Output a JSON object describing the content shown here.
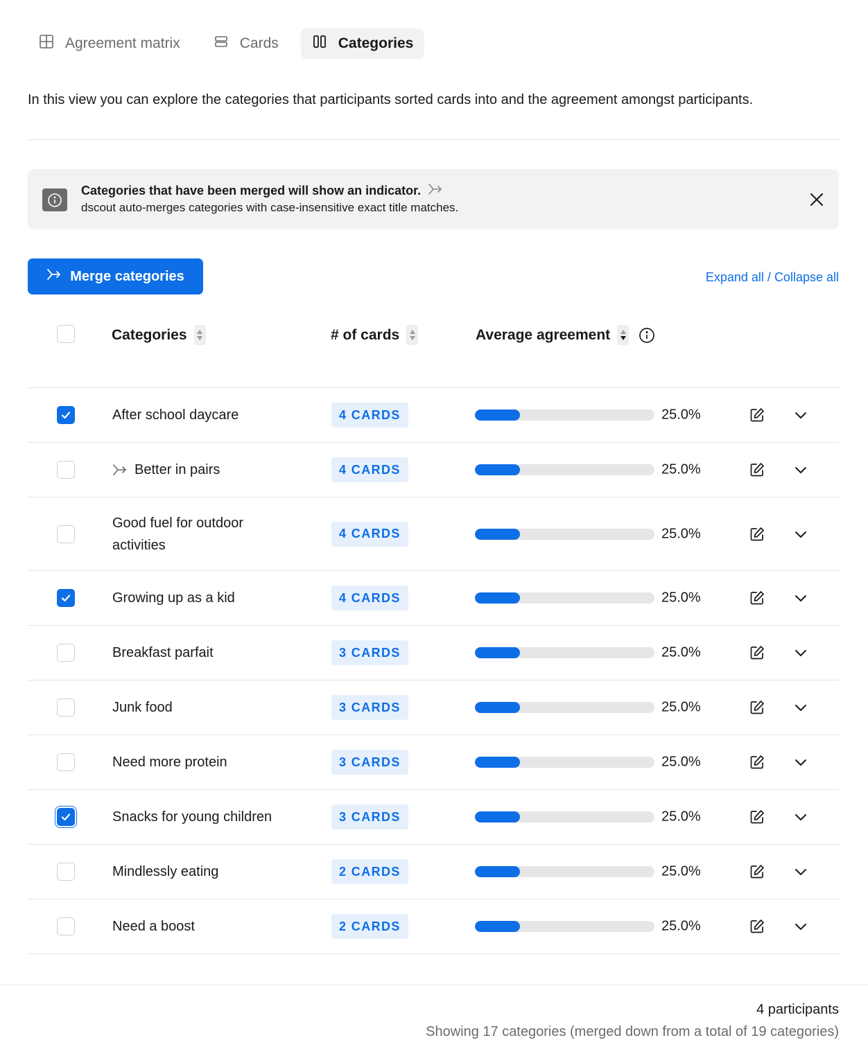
{
  "tabs": [
    {
      "label": "Agreement matrix",
      "icon": "grid-icon",
      "active": false
    },
    {
      "label": "Cards",
      "icon": "cards-icon",
      "active": false
    },
    {
      "label": "Categories",
      "icon": "columns-icon",
      "active": true
    }
  ],
  "intro": "In this view you can explore the categories that participants sorted cards into and the agreement amongst participants.",
  "banner": {
    "title": "Categories that have been merged will show an indicator.",
    "subtitle": "dscout auto-merges categories with case-insensitive exact title matches."
  },
  "toolbar": {
    "merge_label": "Merge categories",
    "expand_all": "Expand all",
    "separator": " / ",
    "collapse_all": "Collapse all"
  },
  "table": {
    "headers": {
      "categories": "Categories",
      "cards": "# of cards",
      "agreement": "Average agreement"
    },
    "rows": [
      {
        "name": "After school daycare",
        "cards": "4 CARDS",
        "agreement": 0.25,
        "agreement_label": "25.0%",
        "checked": true,
        "merged": false
      },
      {
        "name": "Better in pairs",
        "cards": "4 CARDS",
        "agreement": 0.25,
        "agreement_label": "25.0%",
        "checked": false,
        "merged": true
      },
      {
        "name": "Good fuel for outdoor activities",
        "cards": "4 CARDS",
        "agreement": 0.25,
        "agreement_label": "25.0%",
        "checked": false,
        "merged": false
      },
      {
        "name": "Growing up as a kid",
        "cards": "4 CARDS",
        "agreement": 0.25,
        "agreement_label": "25.0%",
        "checked": true,
        "merged": false
      },
      {
        "name": "Breakfast parfait",
        "cards": "3 CARDS",
        "agreement": 0.25,
        "agreement_label": "25.0%",
        "checked": false,
        "merged": false
      },
      {
        "name": "Junk food",
        "cards": "3 CARDS",
        "agreement": 0.25,
        "agreement_label": "25.0%",
        "checked": false,
        "merged": false
      },
      {
        "name": "Need more protein",
        "cards": "3 CARDS",
        "agreement": 0.25,
        "agreement_label": "25.0%",
        "checked": false,
        "merged": false
      },
      {
        "name": "Snacks for young children",
        "cards": "3 CARDS",
        "agreement": 0.25,
        "agreement_label": "25.0%",
        "checked": true,
        "merged": false
      },
      {
        "name": "Mindlessly eating",
        "cards": "2 CARDS",
        "agreement": 0.25,
        "agreement_label": "25.0%",
        "checked": false,
        "merged": false
      },
      {
        "name": "Need a boost",
        "cards": "2 CARDS",
        "agreement": 0.25,
        "agreement_label": "25.0%",
        "checked": false,
        "merged": false
      }
    ]
  },
  "footer": {
    "participants": "4 participants",
    "summary": "Showing 17 categories (merged down from a total of 19 categories)"
  },
  "colors": {
    "accent": "#0e6ee6",
    "badge_bg": "#e6f0fc",
    "track": "#e6e6e6",
    "banner_bg": "#f2f2f2"
  }
}
